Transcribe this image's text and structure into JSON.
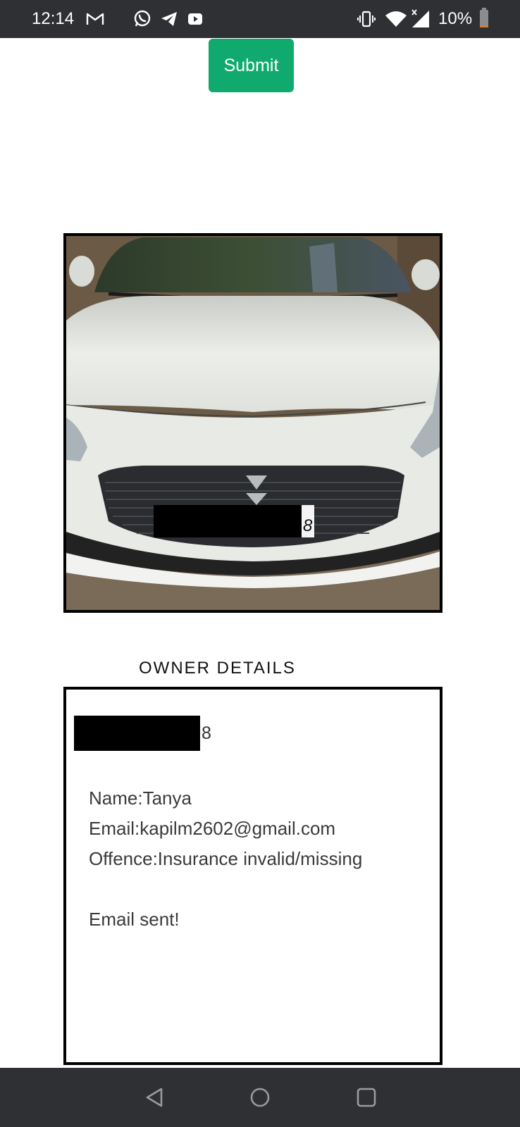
{
  "status_bar": {
    "time": "12:14",
    "battery_percent": "10%",
    "battery_level": 0.1,
    "icons": [
      "gmail-icon",
      "whatsapp-icon",
      "telegram-icon",
      "youtube-icon",
      "vibrate-icon",
      "wifi-icon",
      "cell-signal-icon",
      "battery-icon"
    ]
  },
  "form": {
    "submit_label": "Submit"
  },
  "photo": {
    "plate_visible_suffix": "8"
  },
  "owner_details": {
    "title": "OWNER DETAILS",
    "plate_suffix": "8",
    "name_line": "Name:Tanya",
    "email_line": "Email:kapilm2602@gmail.com",
    "offence_line": "Offence:Insurance invalid/missing",
    "status_line": "Email sent!"
  },
  "nav_bar": {
    "icons": [
      "back-icon",
      "home-icon",
      "recents-icon"
    ]
  },
  "colors": {
    "accent": "#11aa6e",
    "system_bar": "#2f3034",
    "battery_low": "#e07a2e"
  }
}
